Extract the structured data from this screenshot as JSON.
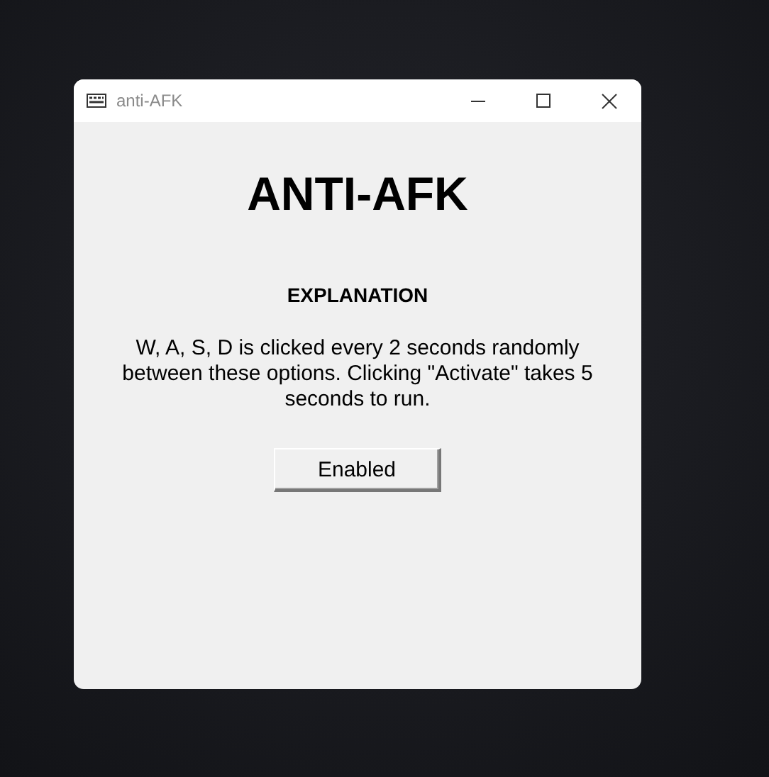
{
  "window": {
    "title": "anti-AFK"
  },
  "heading": "ANTI-AFK",
  "subheading": "EXPLANATION",
  "explanation": "W, A, S, D is clicked every 2 seconds randomly between these options. Clicking \"Activate\" takes 5 seconds to run.",
  "buttons": [
    {
      "label": "Enabled"
    }
  ]
}
